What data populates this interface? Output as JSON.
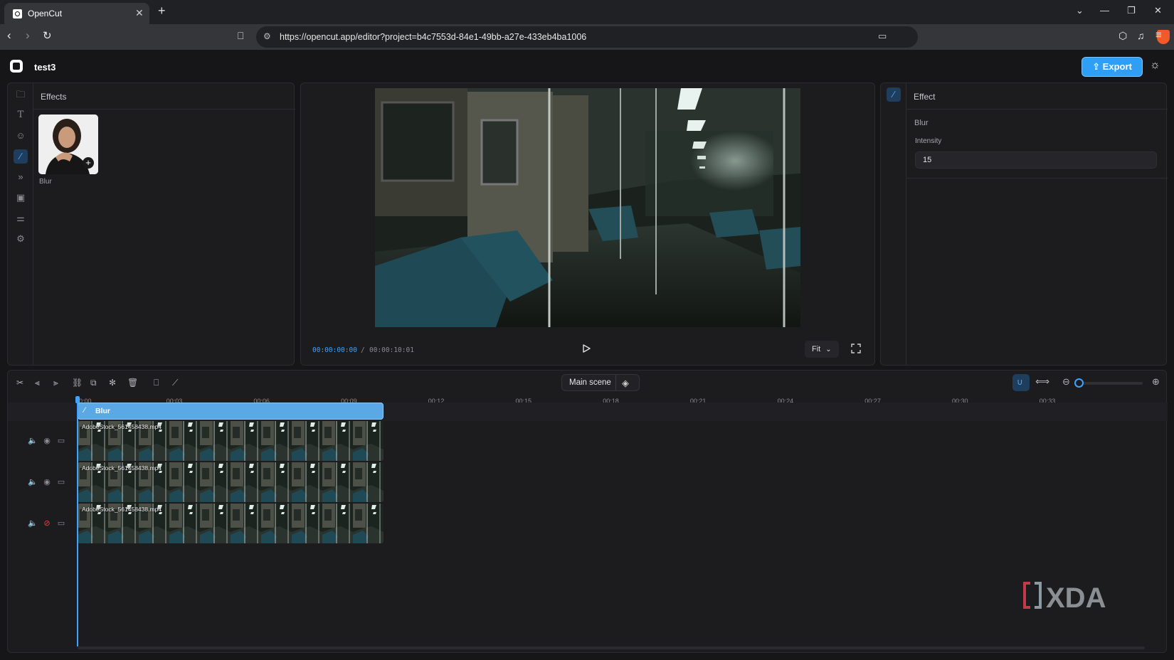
{
  "browser": {
    "tab_title": "OpenCut",
    "url": "https://opencut.app/editor?project=b4c7553d-84e1-49bb-a27e-433eb4ba1006"
  },
  "header": {
    "project_name": "test3",
    "export_label": "Export"
  },
  "left_panel": {
    "title": "Effects",
    "rail_icons": [
      "folder-icon",
      "text-icon",
      "sticker-icon",
      "effects-wand-icon",
      "transitions-icon",
      "captions-icon",
      "adjust-icon",
      "settings-icon"
    ],
    "active_rail": "effects-wand-icon",
    "effects": [
      {
        "label": "Blur"
      }
    ]
  },
  "preview": {
    "current_time": "00:00:00:00",
    "separator": "/",
    "total_time": "00:00:10:01",
    "fit_label": "Fit"
  },
  "right_panel": {
    "title": "Effect",
    "property_name": "Blur",
    "intensity_label": "Intensity",
    "intensity_value": "15"
  },
  "timeline": {
    "scene_label": "Main scene",
    "ticks": [
      "0:00",
      "00:03",
      "00:06",
      "00:09",
      "00:12",
      "00:15",
      "00:18",
      "00:21",
      "00:24",
      "00:27",
      "00:30",
      "00:33"
    ],
    "effect_clip_label": "Blur",
    "video_clips": [
      {
        "name": "AdobeStock_561458438.mp4"
      },
      {
        "name": "AdobeStock_561458438.mp4"
      },
      {
        "name": "AdobeStock_561458438.mp4"
      }
    ],
    "zoom_level": 0.0
  },
  "watermark": "XDA",
  "colors": {
    "accent": "#3da3ff",
    "export": "#2f9ef5",
    "effect_clip": "#5aa9e6",
    "hidden_track": "#e0443a"
  }
}
